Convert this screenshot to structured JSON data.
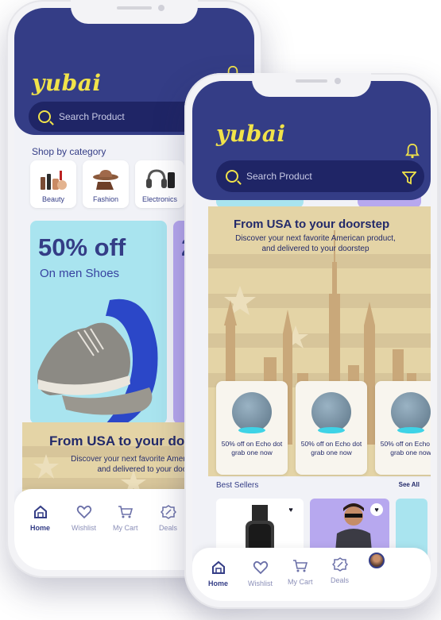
{
  "brand": {
    "logo_text": "yubai"
  },
  "phone_left": {
    "search": {
      "placeholder": "Search Product"
    },
    "categories_title": "Shop by category",
    "categories": [
      {
        "label": "Beauty"
      },
      {
        "label": "Fashion"
      },
      {
        "label": "Electronics"
      }
    ],
    "promo": {
      "headline": "50% off",
      "subline": "On men Shoes",
      "next_peek": "2"
    },
    "usa_banner": {
      "title": "From USA to your doorstep",
      "description": "Discover your next favorite American product, and delivered to your doorstep"
    },
    "tabs": [
      {
        "label": "Home",
        "icon": "home-icon",
        "active": true
      },
      {
        "label": "Wishlist",
        "icon": "heart-icon",
        "active": false
      },
      {
        "label": "My Cart",
        "icon": "cart-icon",
        "active": false
      },
      {
        "label": "Deals",
        "icon": "discount-icon",
        "active": false
      }
    ]
  },
  "phone_right": {
    "search": {
      "placeholder": "Search Product"
    },
    "usa_banner": {
      "title": "From USA to your doorstep",
      "description": "Discover your next favorite American product, and delivered to your doorstep"
    },
    "deals": [
      {
        "label": "50% off on Echo dot grab one now"
      },
      {
        "label": "50% off on Echo dot grab one now"
      },
      {
        "label": "50% off on Echo dot grab one now"
      }
    ],
    "best_sellers": {
      "title": "Best Sellers",
      "see_all": "See All"
    },
    "tabs": [
      {
        "label": "Home",
        "icon": "home-icon",
        "active": true
      },
      {
        "label": "Wishlist",
        "icon": "heart-icon",
        "active": false
      },
      {
        "label": "My Cart",
        "icon": "cart-icon",
        "active": false
      },
      {
        "label": "Deals",
        "icon": "discount-icon",
        "active": false
      },
      {
        "label": "",
        "icon": "avatar",
        "active": false
      }
    ]
  },
  "colors": {
    "primary": "#343d86",
    "accent": "#f1e34a",
    "promo_blue": "#a9e4ef",
    "promo_purple": "#b7a8ef",
    "usa_beige": "#e4d4a6"
  }
}
